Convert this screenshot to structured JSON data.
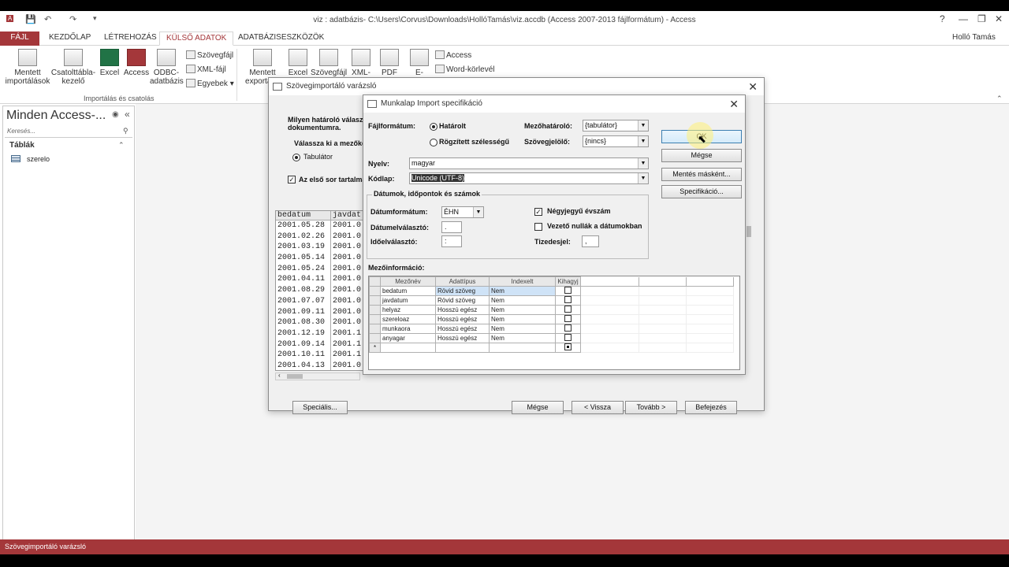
{
  "window": {
    "title": "viz : adatbázis- C:\\Users\\Corvus\\Downloads\\HollóTamás\\viz.accdb (Access 2007-2013 fájlformátum) - Access",
    "user": "Holló Tamás",
    "help": "?"
  },
  "ribbon_tabs": [
    "FÁJL",
    "KEZDŐLAP",
    "LÉTREHOZÁS",
    "KÜLSŐ ADATOK",
    "ADATBÁZISESZKÖZÖK"
  ],
  "ribbon": {
    "import_group": [
      {
        "label": "Mentett importálások"
      },
      {
        "label": "Csatolttábla-kezelő"
      },
      {
        "label": "Excel"
      },
      {
        "label": "Access"
      },
      {
        "label": "ODBC-adatbázis"
      }
    ],
    "import_small": [
      "Szövegfájl",
      "XML-fájl",
      "Egyebek"
    ],
    "import_group_label": "Importálás és csatolás",
    "export_group": [
      {
        "label": "Mentett exportál..."
      },
      {
        "label": "Excel"
      },
      {
        "label": "Szövegfájl"
      },
      {
        "label": "XML-"
      },
      {
        "label": "PDF"
      },
      {
        "label": "E-"
      }
    ],
    "export_small": [
      "Access",
      "Word-körlevél"
    ]
  },
  "nav": {
    "title": "Minden Access-...",
    "search_placeholder": "Keresés...",
    "section": "Táblák",
    "items": [
      "szerelo"
    ]
  },
  "status": "Szövegimportáló varázsló",
  "wizard": {
    "title": "Szövegimportáló varázsló",
    "question": "Milyen határoló válaszl dokumentumra.",
    "choose_label": "Válassza ki a mezőke",
    "option_tab": "Tabulátor",
    "first_row": "Az első sor tartalma",
    "preview_headers": [
      "bedatum",
      "javdat"
    ],
    "preview_rows": [
      [
        "2001.05.28",
        "2001.0"
      ],
      [
        "2001.02.26",
        "2001.0"
      ],
      [
        "2001.03.19",
        "2001.0"
      ],
      [
        "2001.05.14",
        "2001.0"
      ],
      [
        "2001.05.24",
        "2001.0"
      ],
      [
        "2001.04.11",
        "2001.0"
      ],
      [
        "2001.08.29",
        "2001.0"
      ],
      [
        "2001.07.07",
        "2001.0"
      ],
      [
        "2001.09.11",
        "2001.0"
      ],
      [
        "2001.08.30",
        "2001.0"
      ],
      [
        "2001.12.19",
        "2001.1"
      ],
      [
        "2001.09.14",
        "2001.1"
      ],
      [
        "2001.10.11",
        "2001.1"
      ],
      [
        "2001.04.13",
        "2001.0"
      ]
    ],
    "buttons": {
      "special": "Speciális...",
      "cancel": "Mégse",
      "back": "< Vissza",
      "next": "Tovább >",
      "finish": "Befejezés"
    }
  },
  "spec": {
    "title": "Munkalap Import specifikáció",
    "file_format_label": "Fájlformátum:",
    "delimited": "Határolt",
    "fixed_width": "Rögzített szélességű",
    "field_delim_label": "Mezőhatároló:",
    "field_delim_value": "{tabulátor}",
    "text_qual_label": "Szövegjelölő:",
    "text_qual_value": "{nincs}",
    "language_label": "Nyelv:",
    "language_value": "magyar",
    "codepage_label": "Kódlap:",
    "codepage_value": "Unicode (UTF-8)",
    "dates_group": "Dátumok, időpontok és számok",
    "date_order_label": "Dátumformátum:",
    "date_order_value": "ÉHN",
    "date_delim_label": "Dátumelválasztó:",
    "date_delim_value": ".",
    "time_delim_label": "Időelválasztó:",
    "time_delim_value": ":",
    "four_digit_years": "Négyjegyű évszám",
    "leading_zeros": "Vezető nullák a dátumokban",
    "decimal_label": "Tizedesjel:",
    "decimal_value": ",",
    "field_info_label": "Mezőinformáció:",
    "grid_headers": [
      "Mezőnév",
      "Adattípus",
      "Indexelt",
      "Kihagyj"
    ],
    "fields": [
      {
        "name": "bedatum",
        "type": "Rövid szöveg",
        "indexed": "Nem"
      },
      {
        "name": "javdatum",
        "type": "Rövid szöveg",
        "indexed": "Nem"
      },
      {
        "name": "helyaz",
        "type": "Hosszú egész",
        "indexed": "Nem"
      },
      {
        "name": "szereloaz",
        "type": "Hosszú egész",
        "indexed": "Nem"
      },
      {
        "name": "munkaora",
        "type": "Hosszú egész",
        "indexed": "Nem"
      },
      {
        "name": "anyagar",
        "type": "Hosszú egész",
        "indexed": "Nem"
      }
    ],
    "new_row_marker": "*",
    "buttons": {
      "ok": "OK",
      "cancel": "Mégse",
      "save_as": "Mentés másként...",
      "specs": "Specifikáció..."
    }
  }
}
